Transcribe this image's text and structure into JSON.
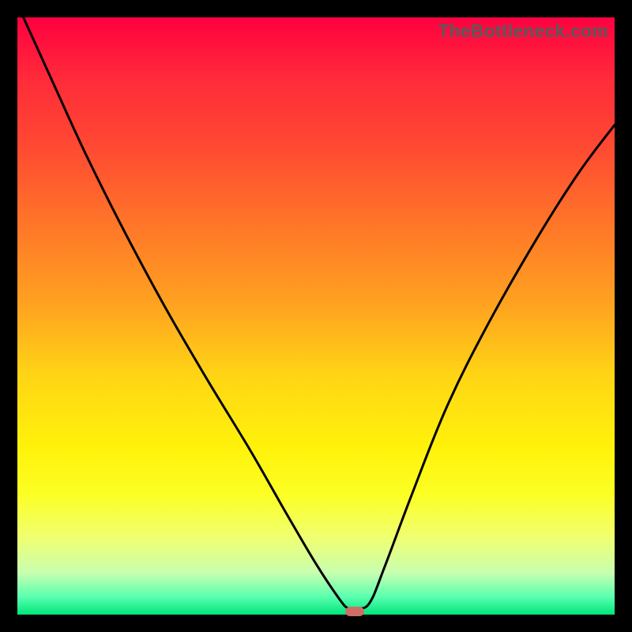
{
  "watermark": "TheBottleneck.com",
  "chart_data": {
    "type": "line",
    "title": "",
    "xlabel": "",
    "ylabel": "",
    "xlim": [
      0,
      1
    ],
    "ylim": [
      0,
      1
    ],
    "series": [
      {
        "name": "curve",
        "x": [
          0.01,
          0.06,
          0.115,
          0.18,
          0.25,
          0.32,
          0.39,
          0.45,
          0.5,
          0.54,
          0.555,
          0.57,
          0.59,
          0.615,
          0.66,
          0.72,
          0.79,
          0.87,
          0.94,
          1.0
        ],
        "y": [
          1.0,
          0.89,
          0.77,
          0.64,
          0.51,
          0.39,
          0.275,
          0.17,
          0.085,
          0.025,
          0.01,
          0.01,
          0.02,
          0.08,
          0.2,
          0.35,
          0.49,
          0.63,
          0.74,
          0.82
        ]
      }
    ],
    "marker": {
      "x": 0.565,
      "y": 0.005
    },
    "colors": {
      "curve": "#000000",
      "marker": "#cc6e66",
      "gradient_top": "#ff0040",
      "gradient_bottom": "#00e67a"
    }
  }
}
